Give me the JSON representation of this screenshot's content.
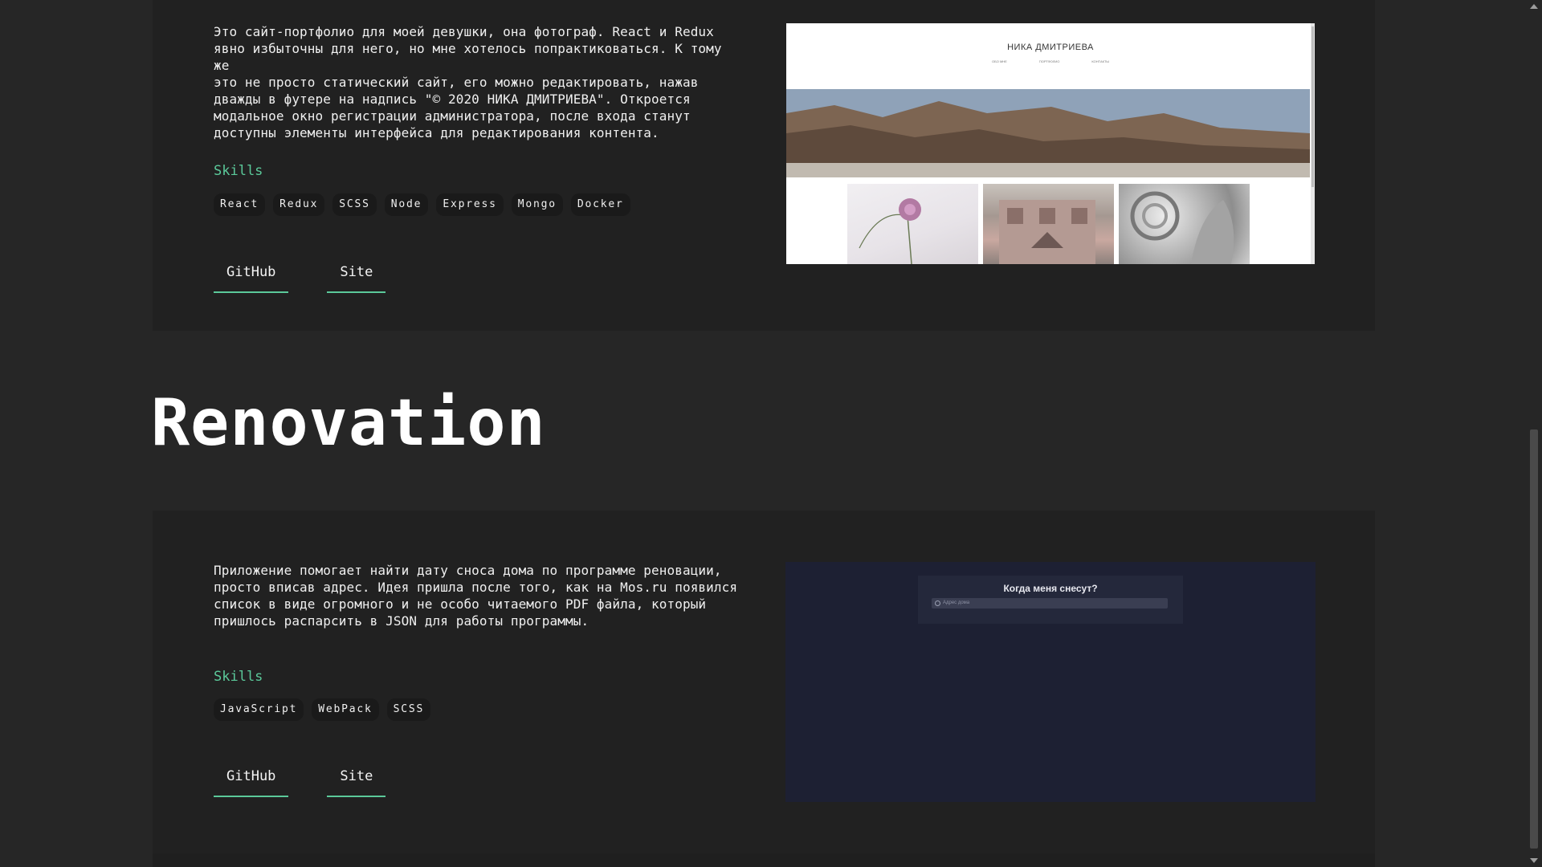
{
  "projects": [
    {
      "description": "Это сайт-портфолио для моей девушки, она фотограф. React и Redux\nявно избыточны для него, но мне хотелось попрактиковаться. К тому же\nэто не просто статический сайт, его можно редактировать, нажав\nдважды в футере на надпись \"© 2020 НИКА ДМИТРИЕВА\". Откроется\nмодальное окно регистрации администратора, после входа станут\nдоступны элементы интерфейса для редактирования контента.",
      "skills_title": "Skills",
      "skills": [
        "React",
        "Redux",
        "SCSS",
        "Node",
        "Express",
        "Mongo",
        "Docker"
      ],
      "links": [
        "GitHub",
        "Site"
      ],
      "screenshot": {
        "brand": "НИКА ДМИТРИЕВА",
        "nav": [
          "ОБО МНЕ",
          "ПОРТФОЛИО",
          "КОНТАКТЫ"
        ]
      }
    },
    {
      "title": "Renovation",
      "description": "Приложение помогает найти дату сноса дома по программе реновации,\nпросто вписав адрес. Идея пришла после того, как на Mos.ru появился\nсписок в виде огромного и не особо читаемого PDF файла, который\nпришлось распарсить в JSON для работы программы.",
      "skills_title": "Skills",
      "skills": [
        "JavaScript",
        "WebPack",
        "SCSS"
      ],
      "links": [
        "GitHub",
        "Site"
      ],
      "screenshot": {
        "title": "Когда меня снесут?",
        "placeholder": "Адрес дома"
      }
    }
  ],
  "colors": {
    "accent": "#5bc99a",
    "background": "#262626",
    "card": "#212121"
  }
}
